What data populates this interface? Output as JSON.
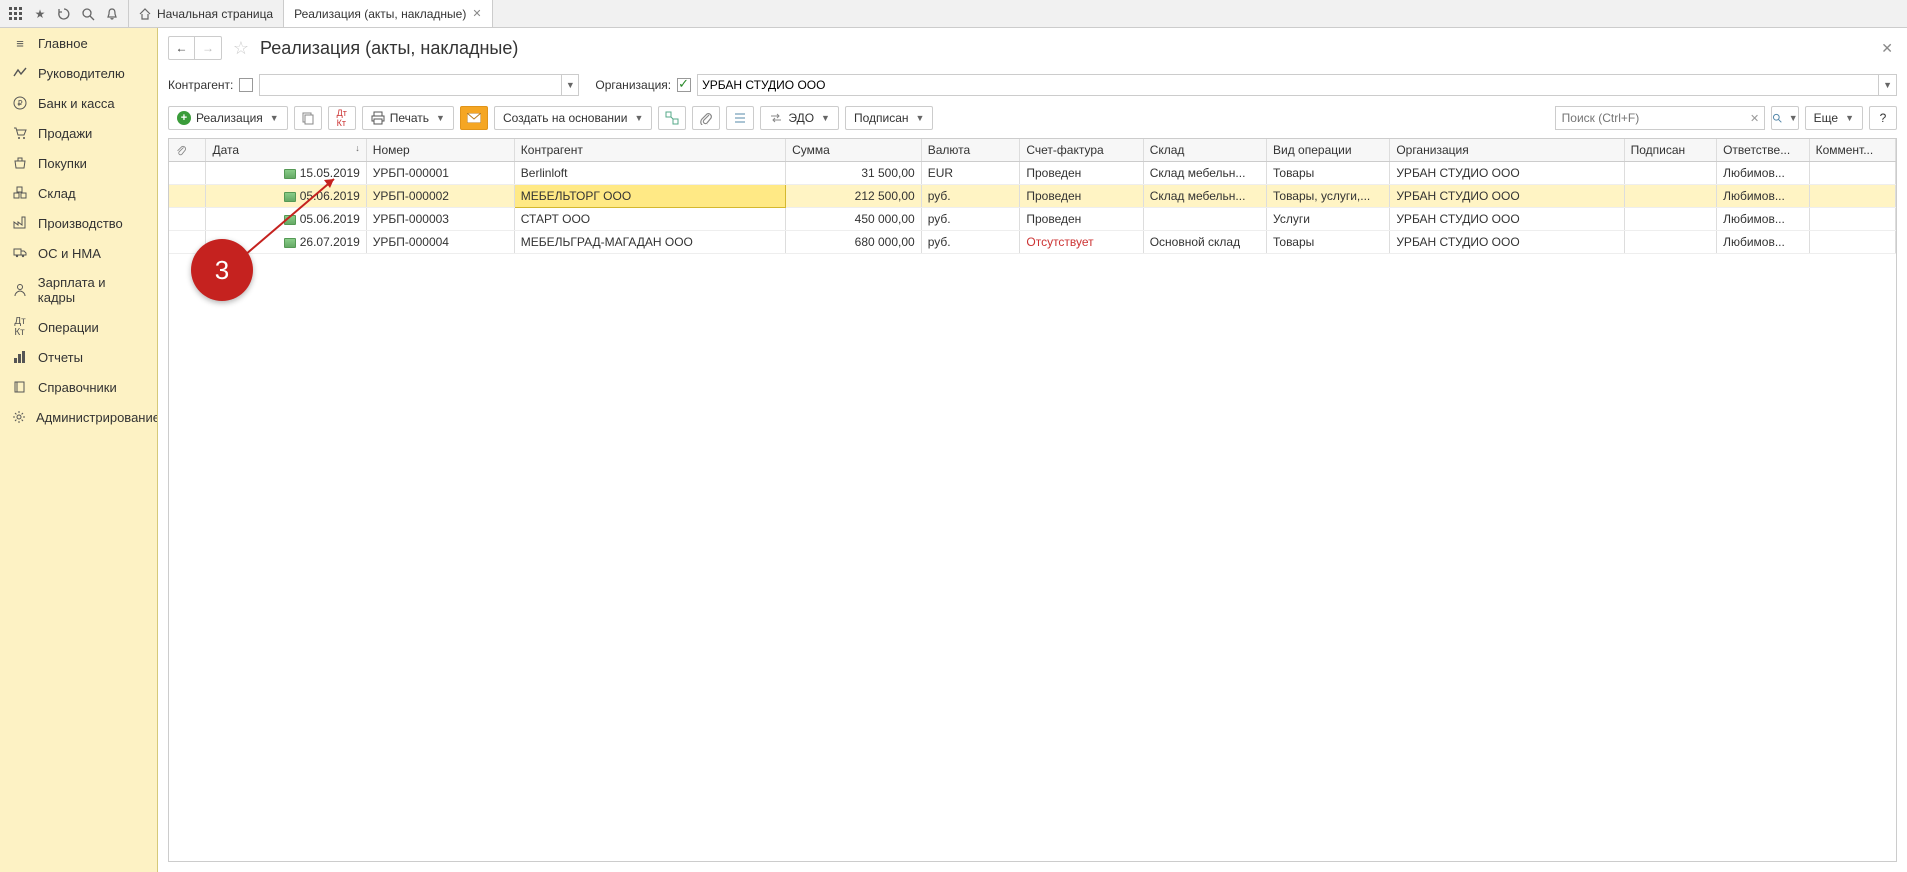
{
  "top_tabs": {
    "home": "Начальная страница",
    "current": "Реализация (акты, накладные)"
  },
  "sidebar": {
    "items": [
      {
        "icon": "home",
        "label": "Главное"
      },
      {
        "icon": "chart",
        "label": "Руководителю"
      },
      {
        "icon": "ruble",
        "label": "Банк и касса"
      },
      {
        "icon": "cart",
        "label": "Продажи"
      },
      {
        "icon": "basket",
        "label": "Покупки"
      },
      {
        "icon": "boxes",
        "label": "Склад"
      },
      {
        "icon": "factory",
        "label": "Производство"
      },
      {
        "icon": "truck",
        "label": "ОС и НМА"
      },
      {
        "icon": "person",
        "label": "Зарплата и кадры"
      },
      {
        "icon": "ops",
        "label": "Операции"
      },
      {
        "icon": "bars",
        "label": "Отчеты"
      },
      {
        "icon": "book",
        "label": "Справочники"
      },
      {
        "icon": "gear",
        "label": "Администрирование"
      }
    ]
  },
  "page": {
    "title": "Реализация (акты, накладные)"
  },
  "filters": {
    "contragent_label": "Контрагент:",
    "contragent_value": "",
    "org_label": "Организация:",
    "org_checked": true,
    "org_value": "УРБАН СТУДИО ООО"
  },
  "toolbar": {
    "realization": "Реализация",
    "print": "Печать",
    "create_based": "Создать на основании",
    "edo": "ЭДО",
    "signed": "Подписан",
    "search_placeholder": "Поиск (Ctrl+F)",
    "more": "Еще",
    "help": "?"
  },
  "table": {
    "columns": [
      "",
      "Дата",
      "Номер",
      "Контрагент",
      "Сумма",
      "Валюта",
      "Счет-фактура",
      "Склад",
      "Вид операции",
      "Организация",
      "Подписан",
      "Ответстве...",
      "Коммент..."
    ],
    "sorted_col": 1,
    "selected_row": 1,
    "highlight_cell": {
      "row": 1,
      "col": 3
    },
    "rows": [
      {
        "date": "15.05.2019",
        "num": "УРБП-000001",
        "party": "Berlinloft",
        "sum": "31 500,00",
        "cur": "EUR",
        "inv": "Проведен",
        "wh": "Склад мебельн...",
        "op": "Товары",
        "org": "УРБАН СТУДИО ООО",
        "sign": "",
        "resp": "Любимов...",
        "comm": ""
      },
      {
        "date": "05.06.2019",
        "num": "УРБП-000002",
        "party": "МЕБЕЛЬТОРГ ООО",
        "sum": "212 500,00",
        "cur": "руб.",
        "inv": "Проведен",
        "wh": "Склад мебельн...",
        "op": "Товары, услуги,...",
        "org": "УРБАН СТУДИО ООО",
        "sign": "",
        "resp": "Любимов...",
        "comm": ""
      },
      {
        "date": "05.06.2019",
        "num": "УРБП-000003",
        "party": "СТАРТ ООО",
        "sum": "450 000,00",
        "cur": "руб.",
        "inv": "Проведен",
        "wh": "",
        "op": "Услуги",
        "org": "УРБАН СТУДИО ООО",
        "sign": "",
        "resp": "Любимов...",
        "comm": ""
      },
      {
        "date": "26.07.2019",
        "num": "УРБП-000004",
        "party": "МЕБЕЛЬГРАД-МАГАДАН ООО",
        "sum": "680 000,00",
        "cur": "руб.",
        "inv": "Отсутствует",
        "inv_red": true,
        "wh": "Основной склад",
        "op": "Товары",
        "org": "УРБАН СТУДИО ООО",
        "sign": "",
        "resp": "Любимов...",
        "comm": ""
      }
    ]
  },
  "annotation": {
    "number": "3"
  }
}
